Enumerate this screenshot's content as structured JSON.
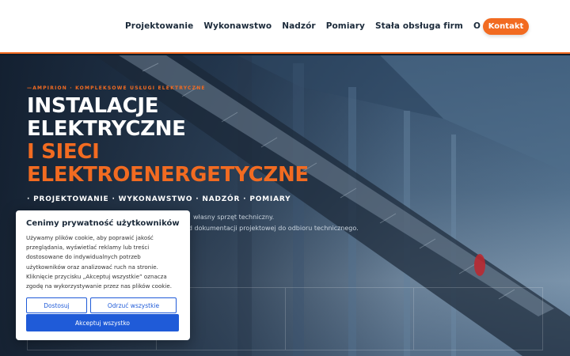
{
  "nav": {
    "items": [
      {
        "label": "Projektowanie"
      },
      {
        "label": "Wykonawstwo"
      },
      {
        "label": "Nadzór"
      },
      {
        "label": "Pomiary"
      },
      {
        "label": "Stała obsługa firm"
      },
      {
        "label": "O nas"
      }
    ],
    "cta_label": "Kontakt"
  },
  "hero": {
    "eyebrow": "—AMPIRION · KOMPLEKSOWE USŁUGI ELEKTRYCZNE",
    "title_line1": "INSTALACJE",
    "title_line2": "ELEKTRYCZNE",
    "title_line3": "I SIECI",
    "title_line4": "ELEKTROENERGETYCZNE",
    "services": "· PROJEKTOWANIE · WYKONAWSTWO · NADZÓR · POMIARY",
    "desc_line1": "własny sprzęt techniczny.",
    "desc_line2": "od dokumentacji projektowej do odbioru technicznego."
  },
  "cookie": {
    "title": "Cenimy prywatność użytkowników",
    "body": "Używamy plików cookie, aby poprawić jakość przeglądania, wyświetlać reklamy lub treści dostosowane do indywidualnych potrzeb użytkowników oraz analizować ruch na stronie. Kliknięcie przycisku „Akceptuj wszystkie” oznacza zgodę na wykorzystywanie przez nas plików cookie.",
    "customize_label": "Dostosuj",
    "reject_label": "Odrzuć wszystkie",
    "accept_label": "Akceptuj wszystko"
  },
  "colors": {
    "accent": "#f26b21",
    "primary_button": "#1f5bd8",
    "nav_text": "#1b2a3a"
  }
}
